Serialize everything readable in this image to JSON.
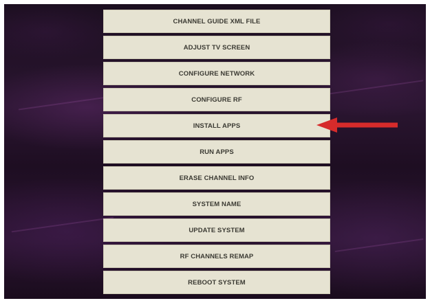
{
  "menu": {
    "items": [
      {
        "label": "CHANNEL GUIDE XML FILE"
      },
      {
        "label": "ADJUST TV SCREEN"
      },
      {
        "label": "CONFIGURE NETWORK"
      },
      {
        "label": "CONFIGURE RF"
      },
      {
        "label": "INSTALL APPS"
      },
      {
        "label": "RUN APPS"
      },
      {
        "label": "ERASE CHANNEL INFO"
      },
      {
        "label": "SYSTEM NAME"
      },
      {
        "label": "UPDATE SYSTEM"
      },
      {
        "label": "RF CHANNELS REMAP"
      },
      {
        "label": "REBOOT SYSTEM"
      }
    ]
  },
  "annotation": {
    "arrow_icon": "left-arrow-icon",
    "points_to": "INSTALL APPS",
    "color": "#d62b2b"
  },
  "colors": {
    "button_bg": "#e6e3d2",
    "button_text": "#3b3a33",
    "background": "#2a1530"
  }
}
